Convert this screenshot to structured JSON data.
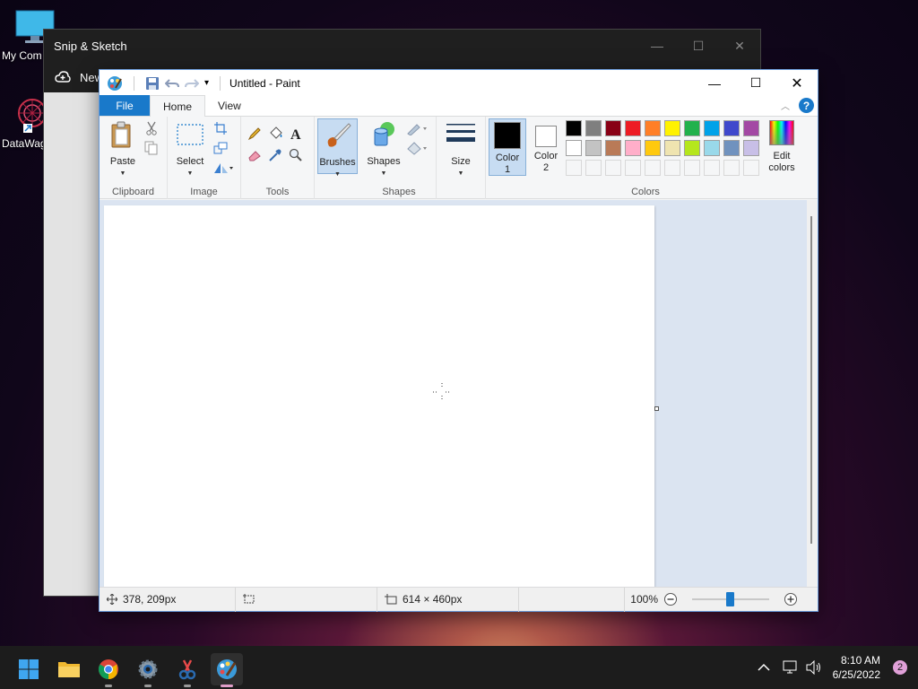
{
  "desktop": {
    "icons": [
      {
        "label": "My Com",
        "icon": "monitor-icon"
      },
      {
        "label": "DataWag",
        "icon": "datawag-app-icon"
      }
    ]
  },
  "snip": {
    "title": "Snip & Sketch",
    "new_label": "New",
    "controls": {
      "minimize": "—",
      "maximize": "☐",
      "close": "✕"
    }
  },
  "paint": {
    "title": "Untitled - Paint",
    "qat": {
      "customize_caret": "▾"
    },
    "window_controls": {
      "minimize": "—",
      "maximize": "☐",
      "close": "✕"
    },
    "tabs": {
      "file": "File",
      "home": "Home",
      "view": "View"
    },
    "ribbon_toggle": "︿",
    "help": "?",
    "groups": {
      "clipboard": {
        "name": "Clipboard",
        "paste": "Paste"
      },
      "image": {
        "name": "Image",
        "select": "Select"
      },
      "tools": {
        "name": "Tools"
      },
      "brushes": {
        "label": "Brushes"
      },
      "shapes": {
        "name": "Shapes",
        "label": "Shapes"
      },
      "size": {
        "label": "Size"
      },
      "colors": {
        "name": "Colors",
        "color1_line1": "Color",
        "color1_line2": "1",
        "color2_line1": "Color",
        "color2_line2": "2",
        "edit_line1": "Edit",
        "edit_line2": "colors",
        "color1_value": "#000000",
        "color2_value": "#ffffff",
        "palette_row1": [
          "#000000",
          "#7f7f7f",
          "#880015",
          "#ed1c24",
          "#ff7f27",
          "#fff200",
          "#22b14c",
          "#00a2e8",
          "#3f48cc",
          "#a349a4"
        ],
        "palette_row2": [
          "#ffffff",
          "#c3c3c3",
          "#b97a57",
          "#ffaec9",
          "#ffc90e",
          "#efe4b0",
          "#b5e61d",
          "#99d9ea",
          "#7092be",
          "#c8bfe7"
        ]
      }
    },
    "status": {
      "cursor_pos": "378, 209px",
      "image_size": "614 × 460px",
      "zoom": "100%",
      "zoom_level": 100
    }
  },
  "taskbar": {
    "apps": [
      "start-icon",
      "file-explorer-icon",
      "chrome-icon",
      "settings-icon",
      "snip-sketch-icon",
      "paint-icon"
    ],
    "time": "8:10 AM",
    "date": "6/25/2022",
    "notifications": "2",
    "tray_chevron": "^"
  }
}
